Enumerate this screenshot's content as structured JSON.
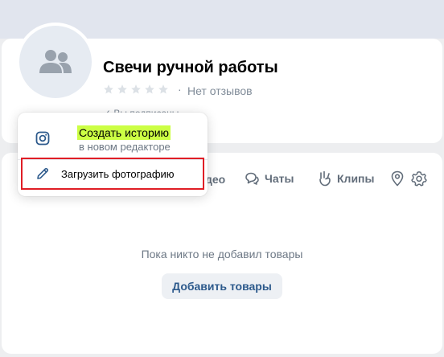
{
  "community": {
    "name": "Свечи ручной работы",
    "rating_dot": "·",
    "reviews": "Нет отзывов",
    "subscribed": "✓ Вы подписаны"
  },
  "tabs": {
    "video": "део",
    "chats": "Чаты",
    "clips": "Клипы"
  },
  "empty_state": {
    "message": "Пока никто не добавил товары",
    "button": "Добавить товары"
  },
  "menu": {
    "story_label": "Создать историю",
    "story_sub": "в новом редакторе",
    "upload_label": "Загрузить фотографию",
    "highlight_color": "#ccff44",
    "outline_color": "#e01e26"
  },
  "icons": [
    "users-icon",
    "star-icon",
    "instagram-icon",
    "pencil-icon",
    "chat-icon",
    "clips-icon",
    "location-icon",
    "gear-icon"
  ]
}
